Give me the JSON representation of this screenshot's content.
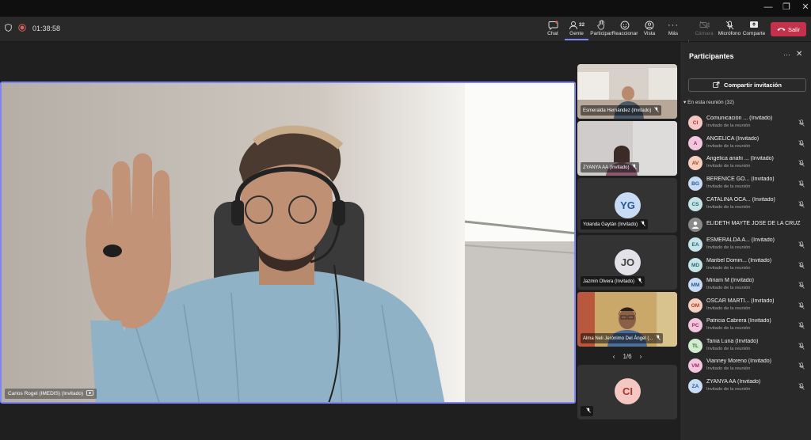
{
  "meeting": {
    "timer": "01:38:58"
  },
  "toolbar": {
    "chat": "Chat",
    "people": "Gente",
    "people_count": "32",
    "raise": "Participar",
    "react": "Reaccionar",
    "view": "Vista",
    "more": "Más",
    "camera": "Cámara",
    "mic": "Micrófono",
    "share": "Comparte",
    "leave": "Salir"
  },
  "main_video": {
    "label": "Carlos Rogel (IMEDIS) (Invitado)"
  },
  "thumbnails": [
    {
      "label": "Esmeralda Hernández (Invitado)",
      "type": "video"
    },
    {
      "label": "ZYANYA AA (Invitado)",
      "type": "video"
    },
    {
      "label": "Yolanda Gaytán (Invitado)",
      "initials": "YG",
      "type": "avatar"
    },
    {
      "label": "Jazmin Olvera (Invitado)",
      "initials": "JO",
      "type": "avatar"
    },
    {
      "label": "Alma Neli Jerónimo Del Ángel (...",
      "type": "video"
    },
    {
      "label": "",
      "initials": "CI",
      "type": "avatar"
    }
  ],
  "pager": {
    "text": "1/6"
  },
  "panel": {
    "title": "Participantes",
    "invite": "Compartir invitación",
    "section": "En esta reunión (32)",
    "participants": [
      {
        "initials": "CI",
        "name": "Comunicación ... (Invitado)",
        "role": "Invitado de la reunión",
        "color": "#f4c7c3",
        "fg": "#a33"
      },
      {
        "initials": "A",
        "name": "ANGELICA (Invitado)",
        "role": "Invitado de la reunión",
        "color": "#f3c6df",
        "fg": "#9b2a62"
      },
      {
        "initials": "AV",
        "name": "Angelica anahi ... (Invitado)",
        "role": "Invitado de la reunión",
        "color": "#f6cfc0",
        "fg": "#a4442a"
      },
      {
        "initials": "BG",
        "name": "BERENICE GO... (Invitado)",
        "role": "Invitado de la reunión",
        "color": "#c9dcf5",
        "fg": "#2c5890"
      },
      {
        "initials": "CS",
        "name": "CATALINA OCA... (Invitado)",
        "role": "Invitado de la reunión",
        "color": "#c7e4e8",
        "fg": "#2a6a73"
      },
      {
        "initials": "",
        "name": "ELIDETH MAYTE JOSE DE LA CRUZ",
        "role": "",
        "color": "#8a8a8a",
        "fg": "#fff"
      },
      {
        "initials": "EA",
        "name": "ESMERALDA A... (Invitado)",
        "role": "Invitado de la reunión",
        "color": "#c7e4e8",
        "fg": "#2a6a73"
      },
      {
        "initials": "MD",
        "name": "Maribel Domin... (Invitado)",
        "role": "Invitado de la reunión",
        "color": "#c7e4e8",
        "fg": "#2a6a73"
      },
      {
        "initials": "MM",
        "name": "Miriam M (Invitado)",
        "role": "Invitado de la reunión",
        "color": "#c9dcf5",
        "fg": "#2c5890"
      },
      {
        "initials": "OM",
        "name": "OSCAR MARTI... (Invitado)",
        "role": "Invitado de la reunión",
        "color": "#f6cfc0",
        "fg": "#a4442a"
      },
      {
        "initials": "PC",
        "name": "Patricia Cabrera (Invitado)",
        "role": "Invitado de la reunión",
        "color": "#f3c6df",
        "fg": "#9b2a62"
      },
      {
        "initials": "TL",
        "name": "Tania Luna (Invitado)",
        "role": "Invitado de la reunión",
        "color": "#d2ecd0",
        "fg": "#2f6b2a"
      },
      {
        "initials": "VM",
        "name": "Vianney Moreno (Invitado)",
        "role": "Invitado de la reunión",
        "color": "#f3c6df",
        "fg": "#9b2a62"
      },
      {
        "initials": "ZA",
        "name": "ZYANYA AA (Invitado)",
        "role": "Invitado de la reunión",
        "color": "#c9dcf5",
        "fg": "#2c5890"
      }
    ]
  }
}
